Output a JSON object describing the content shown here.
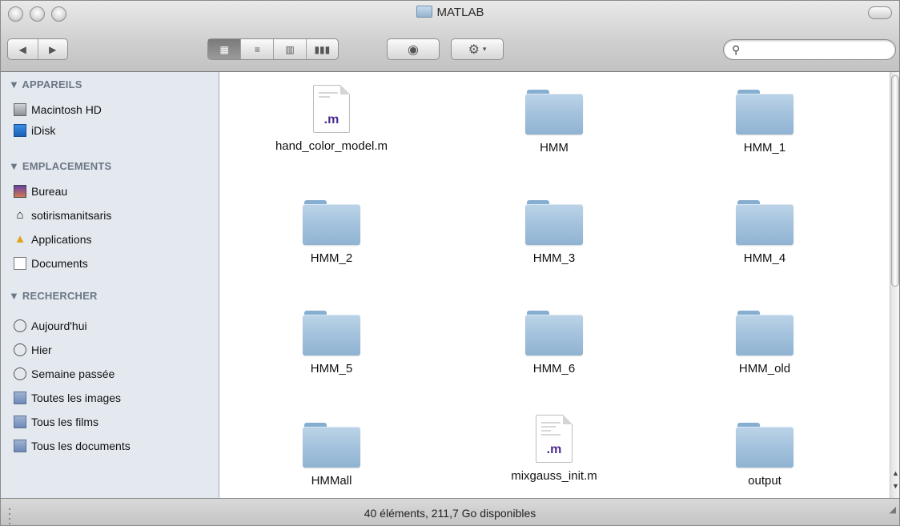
{
  "window": {
    "title": "MATLAB"
  },
  "toolbar": {
    "back_icon": "back-arrow-icon",
    "forward_icon": "forward-arrow-icon",
    "views": [
      "icon-view",
      "list-view",
      "column-view",
      "coverflow-view"
    ],
    "quicklook_icon": "eye-icon",
    "action_icon": "gear-icon",
    "search": {
      "value": "",
      "placeholder": ""
    }
  },
  "sidebar": {
    "sections": [
      {
        "title": "▼ APPAREILS",
        "items": [
          {
            "label": "Macintosh HD",
            "icon": "hard-drive-icon"
          },
          {
            "label": "iDisk",
            "icon": "idisk-icon"
          }
        ]
      },
      {
        "title": "▼ EMPLACEMENTS",
        "items": [
          {
            "label": "Bureau",
            "icon": "desktop-icon"
          },
          {
            "label": "sotirismanitsaris",
            "icon": "home-icon"
          },
          {
            "label": "Applications",
            "icon": "applications-icon"
          },
          {
            "label": "Documents",
            "icon": "documents-icon"
          }
        ]
      },
      {
        "title": "▼ RECHERCHER",
        "items": [
          {
            "label": "Aujourd'hui",
            "icon": "clock-icon"
          },
          {
            "label": "Hier",
            "icon": "clock-icon"
          },
          {
            "label": "Semaine passée",
            "icon": "clock-icon"
          },
          {
            "label": "Toutes les images",
            "icon": "smart-folder-icon"
          },
          {
            "label": "Tous les films",
            "icon": "smart-folder-icon"
          },
          {
            "label": "Tous les documents",
            "icon": "smart-folder-icon"
          }
        ]
      }
    ]
  },
  "files": [
    {
      "name": "hand_color_model.m",
      "type": "m-file",
      "ext": ".m"
    },
    {
      "name": "HMM",
      "type": "folder"
    },
    {
      "name": "HMM_1",
      "type": "folder"
    },
    {
      "name": "HMM_2",
      "type": "folder"
    },
    {
      "name": "HMM_3",
      "type": "folder"
    },
    {
      "name": "HMM_4",
      "type": "folder"
    },
    {
      "name": "HMM_5",
      "type": "folder"
    },
    {
      "name": "HMM_6",
      "type": "folder"
    },
    {
      "name": "HMM_old",
      "type": "folder"
    },
    {
      "name": "HMMall",
      "type": "folder"
    },
    {
      "name": "mixgauss_init.m",
      "type": "m-file",
      "ext": ".m"
    },
    {
      "name": "output",
      "type": "folder"
    }
  ],
  "status": {
    "text": "40 éléments, 211,7 Go disponibles"
  }
}
